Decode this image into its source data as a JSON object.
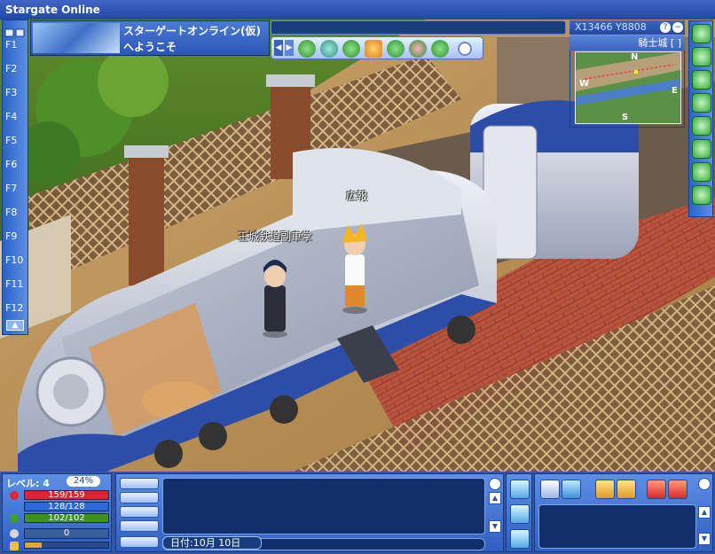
{
  "window": {
    "title": "Stargate Online"
  },
  "fkeys": [
    "F1",
    "F2",
    "F3",
    "F4",
    "F5",
    "F6",
    "F7",
    "F8",
    "F9",
    "F10",
    "F11",
    "F12"
  ],
  "welcome": {
    "line1": "スターゲートオンライン(仮)",
    "line2": "へようこそ"
  },
  "emote_icons": [
    "stop-emote-icon",
    "bubble-2-emote-icon",
    "sleep-emote-icon",
    "sorry-emote-icon",
    "wave-emote-icon",
    "heart-emote-icon",
    "dizzy-emote-icon",
    "close-emote-icon"
  ],
  "minimap": {
    "coords": "X13466 Y8808",
    "title": "騎士城",
    "title_suffix": "[ ]",
    "compass": {
      "n": "N",
      "s": "S",
      "e": "E",
      "w": "W"
    }
  },
  "characters": [
    {
      "name": "王城鉄道副車掌"
    },
    {
      "name": "広報"
    }
  ],
  "stats": {
    "level_label": "レベル",
    "level_sep": ":",
    "level": "4",
    "exp_pct": "24%",
    "hp": "159/159",
    "hp_ratio": 1.0,
    "mp": "128/128",
    "mp_ratio": 1.0,
    "sp": "102/102",
    "sp_ratio": 1.0,
    "exp": "0",
    "colors": {
      "hp": "#d9272b",
      "mp": "#2b6bd9",
      "sp": "#3f8f2a",
      "exp": "#c9c9c9"
    }
  },
  "chat": {
    "date_label": "日付:10月 10日"
  }
}
